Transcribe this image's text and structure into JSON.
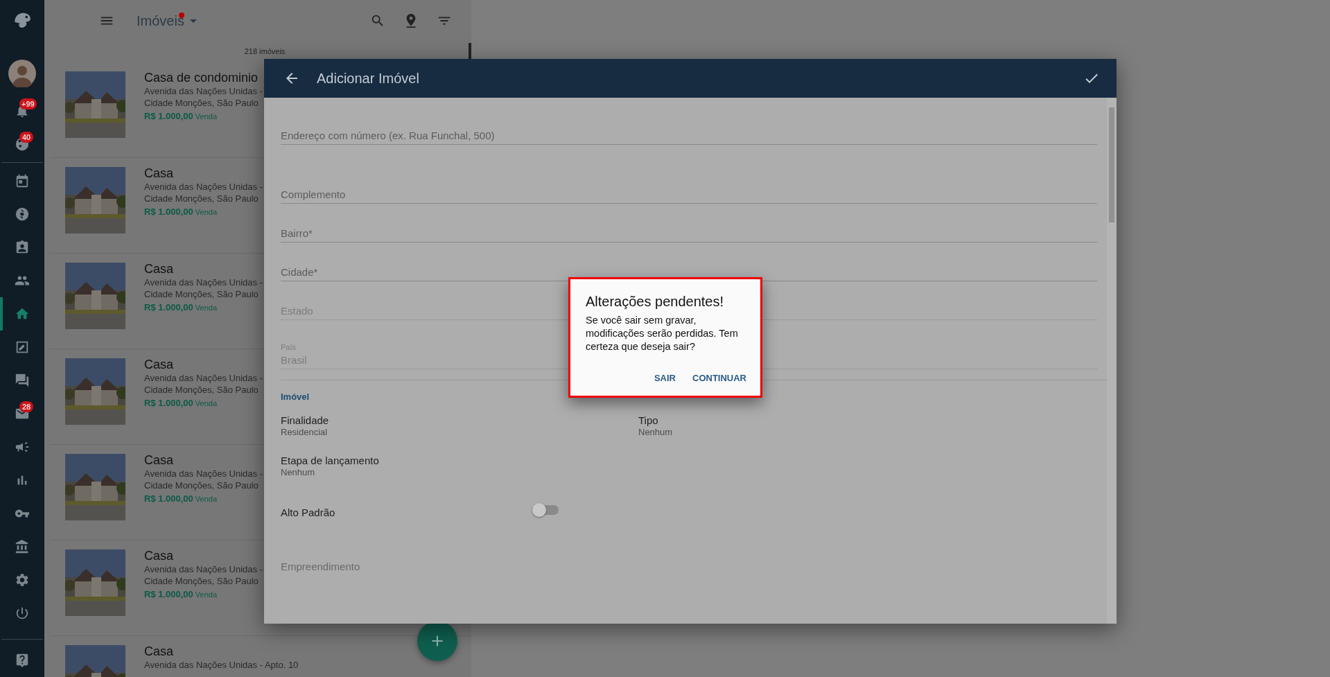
{
  "sidebar": {
    "items": [
      {
        "selected": false,
        "badge": "+99"
      },
      {
        "selected": false,
        "badge": "40"
      },
      {
        "selected": false
      },
      {
        "selected": false
      },
      {
        "selected": false
      },
      {
        "selected": false
      },
      {
        "selected": true
      },
      {
        "selected": false
      },
      {
        "selected": false
      },
      {
        "selected": false,
        "badge": "28"
      },
      {
        "selected": false
      },
      {
        "selected": false
      },
      {
        "selected": false
      },
      {
        "selected": false
      },
      {
        "selected": false
      },
      {
        "selected": false
      },
      {
        "selected": false
      }
    ]
  },
  "list": {
    "title": "Imóveis",
    "count": "218 imóveis",
    "items": [
      {
        "title": "Casa de condominio",
        "address": "Avenida das Nações Unidas -",
        "city": "Cidade Monções, São Paulo",
        "price": "R$ 1.000,00",
        "deal": "Venda"
      },
      {
        "title": "Casa",
        "address": "Avenida das Nações Unidas -",
        "city": "Cidade Monções, São Paulo",
        "price": "R$ 1.000,00",
        "deal": "Venda"
      },
      {
        "title": "Casa",
        "address": "Avenida das Nações Unidas -",
        "city": "Cidade Monções, São Paulo",
        "price": "R$ 1.000,00",
        "deal": "Venda"
      },
      {
        "title": "Casa",
        "address": "Avenida das Nações Unidas -",
        "city": "Cidade Monções, São Paulo",
        "price": "R$ 1.000,00",
        "deal": "Venda"
      },
      {
        "title": "Casa",
        "address": "Avenida das Nações Unidas -",
        "city": "Cidade Monções, São Paulo",
        "price": "R$ 1.000,00",
        "deal": "Venda"
      },
      {
        "title": "Casa",
        "address": "Avenida das Nações Unidas -",
        "city": "Cidade Monções, São Paulo",
        "price": "R$ 1.000,00",
        "deal": "Venda"
      },
      {
        "title": "Casa",
        "address": "Avenida das Nações Unidas - Apto. 10"
      }
    ]
  },
  "modal": {
    "title": "Adicionar Imóvel",
    "fields": [
      {
        "label": "Endereço com número (ex. Rua Funchal, 500)",
        "disabled": false
      },
      {
        "label": "Complemento",
        "disabled": false
      },
      {
        "label": "Bairro*",
        "disabled": false
      },
      {
        "label": "Cidade*",
        "disabled": false
      },
      {
        "label": "Estado",
        "disabled": true
      },
      {
        "label": "País",
        "value": "Brasil",
        "disabled": true
      }
    ],
    "section": {
      "title": "Imóvel",
      "properties": [
        {
          "label": "Finalidade",
          "value": "Residencial"
        },
        {
          "label": "Tipo",
          "value": "Nenhum"
        },
        {
          "label": "Etapa de lançamento",
          "value": "Nenhum"
        }
      ],
      "toggle": {
        "label": "Alto Padrão",
        "on": false
      },
      "next_field": {
        "label": "Empreendimento"
      }
    }
  },
  "dialog": {
    "title": "Alterações pendentes!",
    "message": "Se você sair sem gravar, modificações serão perdidas. Tem certeza que deseja sair?",
    "buttons": [
      "SAIR",
      "CONTINUAR"
    ]
  }
}
